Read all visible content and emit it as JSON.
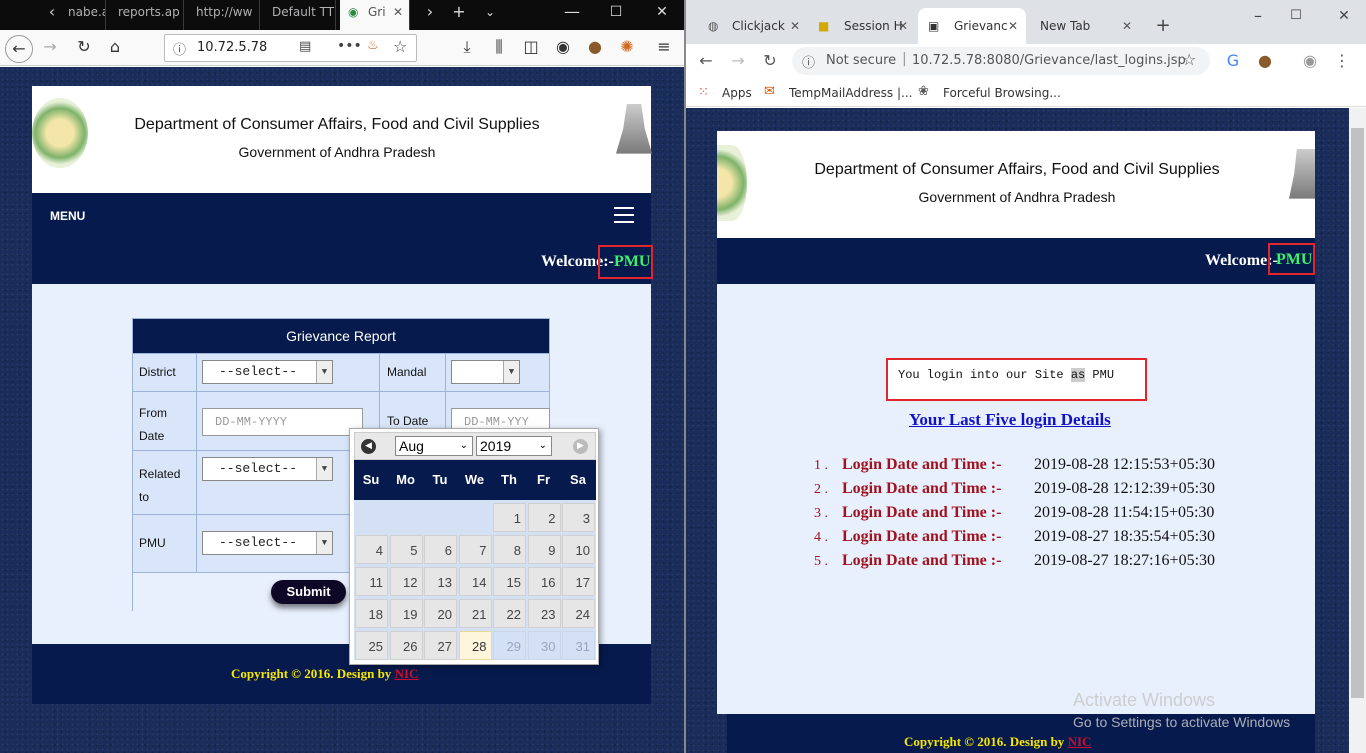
{
  "firefox": {
    "tabs": [
      "nabe.a",
      "reports.ap",
      "http://ww",
      "Default TT",
      "Gri"
    ],
    "url": "10.72.5.78"
  },
  "chrome": {
    "tabs": [
      "Clickjack",
      "Session H",
      "Grievanc",
      "New Tab"
    ],
    "url_secure": "Not secure",
    "url": "10.72.5.78:8080/Grievance/last_logins.jsp",
    "bookmarks": [
      "Apps",
      "TempMailAddress |...",
      "Forceful Browsing..."
    ]
  },
  "site": {
    "dept": "Department of Consumer Affairs, Food and Civil Supplies",
    "gov": "Government of Andhra Pradesh",
    "menu": "MENU",
    "welcome": "Welcome:-",
    "user": "PMU",
    "copyright": "Copyright © 2016. Design by ",
    "nic": "NIC"
  },
  "form": {
    "title": "Grievance Report",
    "district_label": "District",
    "mandal_label": "Mandal",
    "from_label_1": "From",
    "from_label_2": "Date",
    "to_label": "To Date",
    "related_label_1": "Related",
    "related_label_2": "to",
    "pmu_label": "PMU",
    "select_text": "--select--",
    "date_placeholder": "DD-MM-YYYY",
    "date_placeholder_short": "DD-MM-YYY",
    "submit": "Submit"
  },
  "calendar": {
    "month": "Aug",
    "year": "2019",
    "day_names": [
      "Su",
      "Mo",
      "Tu",
      "We",
      "Th",
      "Fr",
      "Sa"
    ],
    "weeks": [
      [
        "",
        "",
        "",
        "",
        "1",
        "2",
        "3"
      ],
      [
        "4",
        "5",
        "6",
        "7",
        "8",
        "9",
        "10"
      ],
      [
        "11",
        "12",
        "13",
        "14",
        "15",
        "16",
        "17"
      ],
      [
        "18",
        "19",
        "20",
        "21",
        "22",
        "23",
        "24"
      ],
      [
        "25",
        "26",
        "27",
        "28",
        "29",
        "30",
        "31"
      ]
    ],
    "today": "28"
  },
  "last_logins": {
    "message": "You login into our Site as PMU",
    "message_pre": "You login into our Site ",
    "message_as": "as",
    "message_post": " PMU",
    "heading": "Your Last Five login Details",
    "label": "Login Date and Time :-",
    "rows": [
      {
        "n": "1 .",
        "value": "2019-08-28 12:15:53+05:30"
      },
      {
        "n": "2 .",
        "value": "2019-08-28 12:12:39+05:30"
      },
      {
        "n": "3 .",
        "value": "2019-08-28 11:54:15+05:30"
      },
      {
        "n": "4 .",
        "value": "2019-08-27 18:35:54+05:30"
      },
      {
        "n": "5 .",
        "value": "2019-08-27 18:27:16+05:30"
      }
    ]
  },
  "watermark": {
    "line1": "Activate Windows",
    "line2": "Go to Settings to activate Windows"
  }
}
